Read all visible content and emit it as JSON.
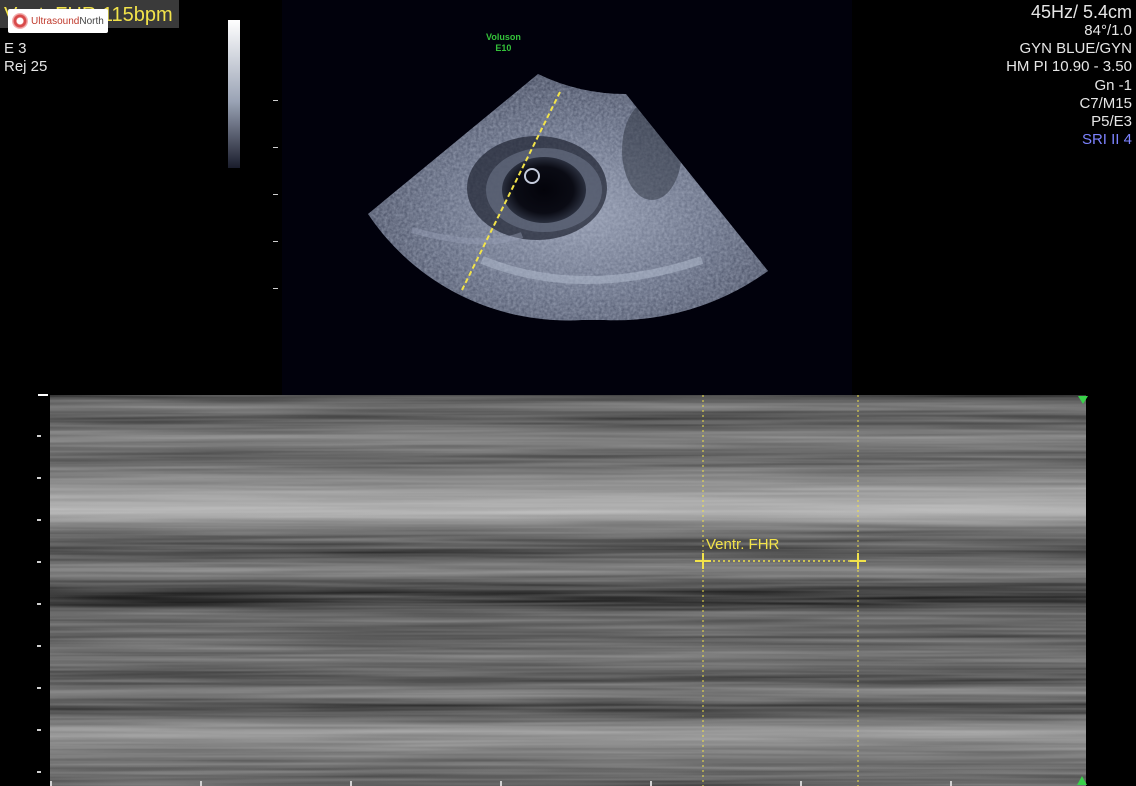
{
  "readout": {
    "fhr_prefix": "Vent. ",
    "fhr_text": "FHR 115bpm",
    "e_label": "E   3",
    "rej_label": "Rej  25"
  },
  "logo": {
    "name_a": "Ultrasound",
    "name_b": "North",
    "icon": "ultrasound-north-logo-icon"
  },
  "brand": {
    "line1": "Voluson",
    "line2": "E10"
  },
  "params": {
    "frame_depth": "45Hz/ 5.4cm",
    "angle": "84°/1.0",
    "preset": "GYN BLUE/GYN",
    "probe_pi": "HM PI 10.90 - 3.50",
    "gain": "Gn  -1",
    "settings": "C7/M15",
    "persistence": "P5/E3",
    "sri": "SRI II 4"
  },
  "measurement": {
    "label": "Ventr. FHR"
  },
  "colors": {
    "caliper": "#f2e34a",
    "brand": "#34c23a",
    "sri": "#7d83ff",
    "marker": "#39d24a"
  }
}
